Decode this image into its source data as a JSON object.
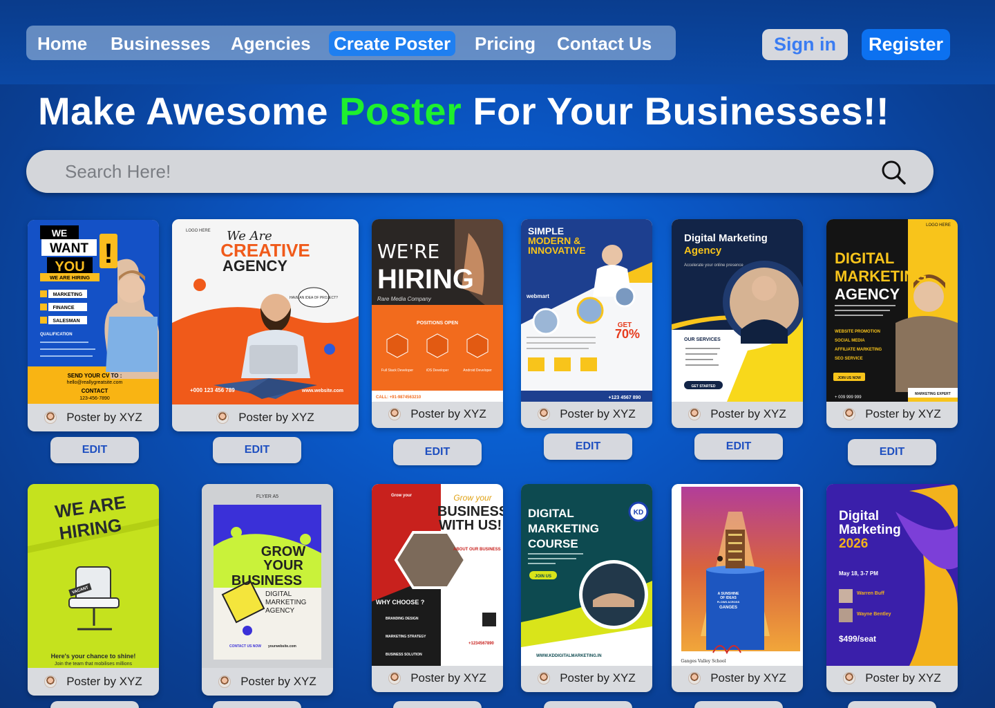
{
  "nav": {
    "items": [
      {
        "label": "Home"
      },
      {
        "label": "Businesses"
      },
      {
        "label": "Agencies"
      },
      {
        "label": "Create Poster"
      },
      {
        "label": "Pricing"
      },
      {
        "label": "Contact Us"
      }
    ],
    "active": "Create Poster"
  },
  "auth": {
    "signin": "Sign in",
    "register": "Register"
  },
  "headline": {
    "part1": "Make Awesome ",
    "highlight": "Poster",
    "part2": " For Your Businesses!!"
  },
  "search": {
    "placeholder": "Search Here!"
  },
  "edit_label": "EDIT",
  "cards": [
    {
      "author": "Poster by XYZ",
      "poster": {
        "line1": "WE",
        "line2": "WANT",
        "line3": "YOU",
        "tag": "WE ARE HIRING",
        "items": [
          "MARKETING",
          "FINANCE",
          "SALESMAN"
        ],
        "footer": "SEND YOUR CV TO :",
        "email": "hello@reallygreatsite.com",
        "contact": "CONTACT",
        "phone": "123-456-7890"
      }
    },
    {
      "author": "Poster by XYZ",
      "poster": {
        "script": "We Are",
        "line1": "CREATIVE",
        "line2": "AGENCY",
        "bubble": "HAVE AN IDEA OF PROJECT?",
        "phone": "+000 123 456 789",
        "site": "www.website.com"
      }
    },
    {
      "author": "Poster by XYZ",
      "poster": {
        "line1": "WE'RE",
        "line2": "HIRING",
        "company": "Rare Media Company",
        "positions": "POSITIONS OPEN",
        "roles": [
          "Full Stack Developer",
          "iOS Developer",
          "Android Developer"
        ],
        "call": "CALL: +91-9874563210"
      }
    },
    {
      "author": "Poster by XYZ",
      "poster": {
        "line1": "SIMPLE",
        "line2": "MODERN &",
        "line3": "INNOVATIVE",
        "brand": "webmart",
        "offer": "70%",
        "offer_label": "GET",
        "phone": "+123 4567 890"
      }
    },
    {
      "author": "Poster by XYZ",
      "poster": {
        "line1": "Digital Marketing",
        "line2": "Agency",
        "sub": "Accelerate your online presence",
        "services": "OUR SERVICES",
        "cta": "GET STARTED"
      }
    },
    {
      "author": "Poster by XYZ",
      "poster": {
        "logo": "LOGO HERE",
        "line1": "DIGITAL",
        "line2": "MARKETING",
        "line3": "AGENCY",
        "items": [
          "WEBSITE PROMOTION",
          "SOCIAL MEDIA",
          "AFFILIATE MARKETING",
          "SEO SERVICE"
        ],
        "cta": "JOIN US NOW",
        "phone": "+ 009 999 999",
        "badge": "MARKETING EXPERT"
      }
    },
    {
      "author": "Poster by XYZ",
      "poster": {
        "line1": "WE ARE",
        "line2": "HIRING",
        "tag": "VACANT",
        "caption": "Here's your chance to shine!",
        "sub": "Join the team that mobilises millions"
      }
    },
    {
      "author": "Poster by XYZ",
      "poster": {
        "top": "FLYER A5",
        "line1": "GROW",
        "line2": "YOUR",
        "line3": "BUSINESS",
        "sub1": "DIGITAL",
        "sub2": "MARKETING",
        "sub3": "AGENCY",
        "contact": "CONTACT US NOW",
        "site": "yourwebsite.com"
      }
    },
    {
      "author": "Poster by XYZ",
      "poster": {
        "script": "Grow your",
        "line1": "BUSINESS",
        "line2": "WITH US!!",
        "about": "ABOUT OUR BUSINESS",
        "why": "WHY CHOOSE ?",
        "items": [
          "BRANDING DESIGN",
          "MARKETING STRATEGY",
          "BUSINESS SOLUTION"
        ],
        "phone": "+1234567890"
      }
    },
    {
      "author": "Poster by XYZ",
      "poster": {
        "line1": "DIGITAL",
        "line2": "MARKETING",
        "line3": "COURSE",
        "logo": "KD",
        "cta": "JOIN US",
        "site": "WWW.KDDIGITALMARKETING.IN"
      }
    },
    {
      "author": "Poster by XYZ",
      "poster": {
        "caption1": "A SUNSHINE",
        "caption2": "OF IDEAS",
        "caption3": "FLOWS ACROSS",
        "caption4": "GANGES",
        "school": "Ganges Valley School"
      }
    },
    {
      "author": "Poster by XYZ",
      "poster": {
        "line1": "Digital",
        "line2": "Marketing",
        "line3": "2026",
        "date": "May 18, 3-7 PM",
        "speaker1": "Warren Buff",
        "speaker2": "Wayne Bentley",
        "price": "$499/seat"
      }
    }
  ]
}
